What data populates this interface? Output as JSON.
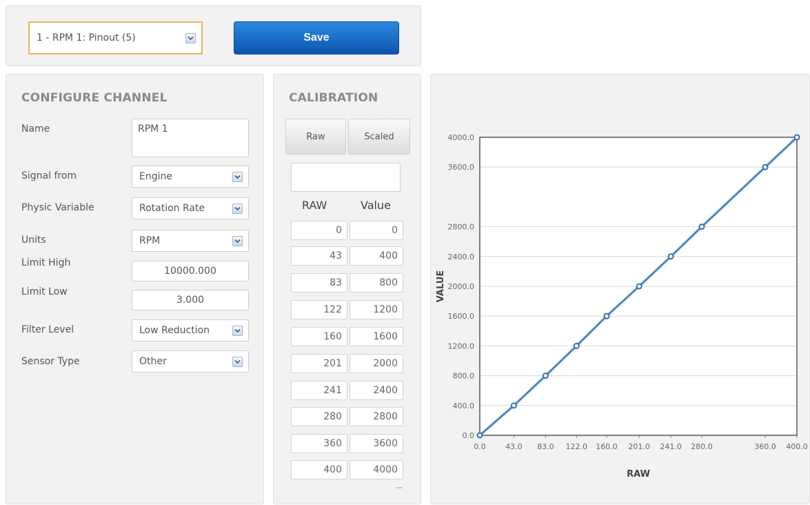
{
  "toolbar": {
    "channel_select": "1 - RPM 1: Pinout (5)",
    "save_label": "Save"
  },
  "configure": {
    "title": "CONFIGURE CHANNEL",
    "fields": {
      "name": {
        "label": "Name",
        "value": "RPM 1"
      },
      "signal_from": {
        "label": "Signal from",
        "value": "Engine"
      },
      "physic_variable": {
        "label": "Physic Variable",
        "value": "Rotation Rate"
      },
      "units": {
        "label": "Units",
        "value": "RPM"
      },
      "limit_high": {
        "label": "Limit High",
        "value": "10000.000"
      },
      "limit_low": {
        "label": "Limit Low",
        "value": "3.000"
      },
      "filter_level": {
        "label": "Filter Level",
        "value": "Low Reduction"
      },
      "sensor_type": {
        "label": "Sensor Type",
        "value": "Other"
      }
    }
  },
  "calibration": {
    "title": "CALIBRATION",
    "raw_button": "Raw",
    "scaled_button": "Scaled",
    "input_value": "",
    "col_raw": "RAW",
    "col_value": "Value",
    "rows": [
      {
        "raw": "0",
        "value": "0"
      },
      {
        "raw": "43",
        "value": "400"
      },
      {
        "raw": "83",
        "value": "800"
      },
      {
        "raw": "122",
        "value": "1200"
      },
      {
        "raw": "160",
        "value": "1600"
      },
      {
        "raw": "201",
        "value": "2000"
      },
      {
        "raw": "241",
        "value": "2400"
      },
      {
        "raw": "280",
        "value": "2800"
      },
      {
        "raw": "360",
        "value": "3600"
      },
      {
        "raw": "400",
        "value": "4000"
      }
    ],
    "remove_symbol": "−"
  },
  "colors": {
    "accent": "#1565c0",
    "line": "#2f6fb0",
    "select_border": "#e3b45a"
  },
  "chart_data": {
    "type": "line",
    "xlabel": "RAW",
    "ylabel": "VALUE",
    "x": [
      0,
      43,
      83,
      122,
      160,
      201,
      241,
      280,
      360,
      400
    ],
    "y": [
      0,
      400,
      800,
      1200,
      1600,
      2000,
      2400,
      2800,
      3600,
      4000
    ],
    "x_ticks": [
      "0.0",
      "43.0",
      "83.0",
      "122.0",
      "160.0",
      "201.0",
      "241.0",
      "280.0",
      "360.0",
      "400.0"
    ],
    "y_ticks": [
      "0.0",
      "400.0",
      "800.0",
      "1200.0",
      "1600.0",
      "2000.0",
      "2400.0",
      "2800.0",
      "3600.0",
      "4000.0"
    ],
    "xlim": [
      0,
      400
    ],
    "ylim": [
      0,
      4000
    ],
    "grid": true
  }
}
